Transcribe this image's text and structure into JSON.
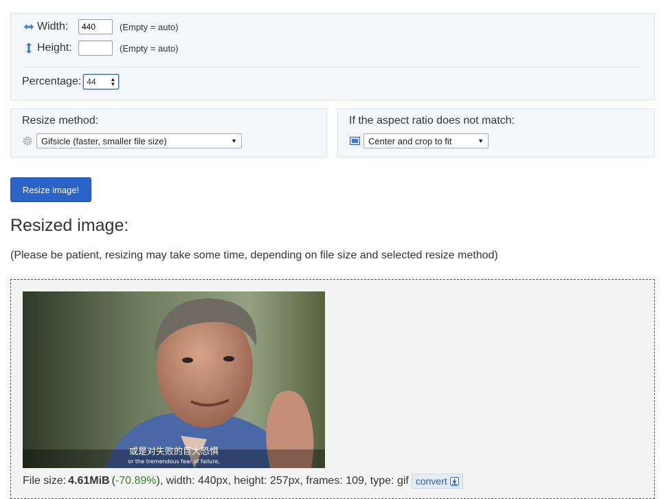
{
  "dimensions": {
    "width_label": "Width:",
    "width_value": "440",
    "width_hint": "(Empty = auto)",
    "height_label": "Height:",
    "height_value": "",
    "height_hint": "(Empty = auto)",
    "percentage_label": "Percentage:",
    "percentage_value": "44"
  },
  "resize_method": {
    "title": "Resize method:",
    "selected": "Gifsicle (faster, smaller file size)",
    "icon": "gear-icon"
  },
  "aspect": {
    "title": "If the aspect ratio does not match:",
    "selected": "Center and crop to fit",
    "icon": "crop-frame-icon"
  },
  "actions": {
    "resize_button": "Resize image!"
  },
  "result": {
    "heading": "Resized image:",
    "note": "(Please be patient, resizing may take some time, depending on file size and selected resize method)",
    "subtitle_cn": "或是对失败的巨大恐惧",
    "subtitle_en": "or the tremendous fear of failure,",
    "file_size_label": "File size:",
    "file_size_value": "4.61MiB",
    "file_size_change_open": "(",
    "file_size_change": "-70.89%",
    "file_size_change_close": ")",
    "details": ", width: 440px, height: 257px, frames: 109, type: gif",
    "convert_label": "convert"
  },
  "colors": {
    "accent": "#2c63c9",
    "panel_bg": "#f5f7fa",
    "change_green": "#2b8a1f"
  }
}
